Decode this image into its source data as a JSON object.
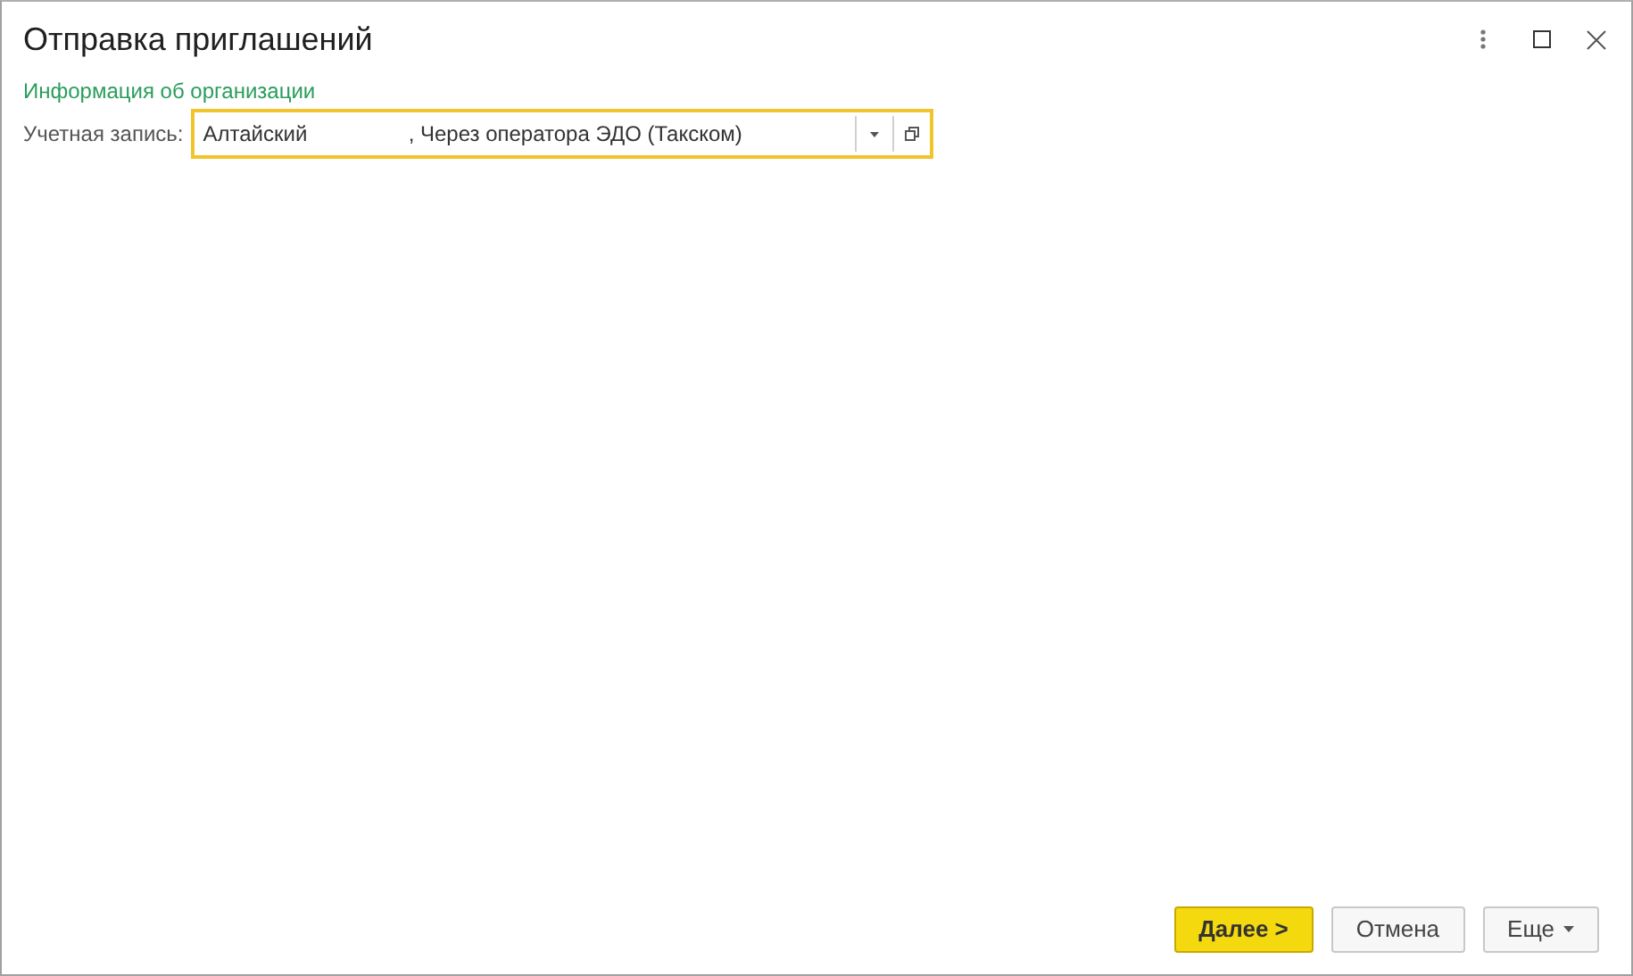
{
  "window": {
    "title": "Отправка приглашений"
  },
  "section": {
    "title": "Информация об организации"
  },
  "account_field": {
    "label": "Учетная запись:",
    "value": "Алтайский                 , Через оператора ЭДО (Такском)",
    "focused": true
  },
  "buttons": [
    {
      "label": "Далее >",
      "kind": "primary"
    },
    {
      "label": "Отмена",
      "kind": "plain"
    },
    {
      "label": "Еще",
      "kind": "menu"
    }
  ]
}
